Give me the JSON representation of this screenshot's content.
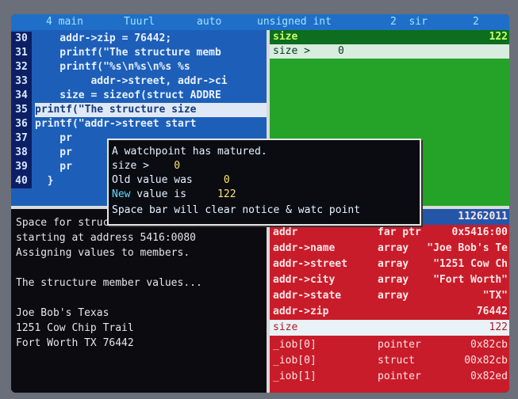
{
  "status_bar": {
    "mode": "4 main",
    "view": "Tuurl",
    "auto": "auto",
    "type": "unsigned int",
    "right1": "2  sir",
    "right2": "2"
  },
  "source": {
    "lines": [
      {
        "num": "30",
        "code": "    addr->zip = 76442;"
      },
      {
        "num": "31",
        "code": "    printf(\"The structure memb"
      },
      {
        "num": "32",
        "code": "    printf(\"%s\\n%s\\n%s %s"
      },
      {
        "num": "33",
        "code": "         addr->street, addr->ci"
      },
      {
        "num": "34",
        "code": "    size = sizeof(struct ADDRE"
      },
      {
        "num": "35",
        "code": "printf(\"The structure size"
      },
      {
        "num": "36",
        "code": "printf(\"addr->street start"
      },
      {
        "num": "37",
        "code": "    pr"
      },
      {
        "num": "38",
        "code": "    pr"
      },
      {
        "num": "39",
        "code": "    pr"
      },
      {
        "num": "40",
        "code": "  }"
      }
    ]
  },
  "watch_pane": {
    "header_left": "size",
    "header_right": "122",
    "row_name": "size >",
    "row_value": "0"
  },
  "notice": {
    "title": "A watchpoint has matured.",
    "size_label": "size >",
    "size_value": "0",
    "old_label": "Old value was",
    "old_value": "0",
    "new_word": "New",
    "new_label": " value is",
    "new_value": "122",
    "hint": "Space bar will clear notice & watc point"
  },
  "console": {
    "lines": [
      "Space for struc",
      "starting at address 5416:0080",
      "Assigning values to members.",
      "",
      "The structure member values...",
      "",
      "Joe Bob's Texas",
      "1251 Cow Chip Trail",
      "Fort Worth TX 76442"
    ]
  },
  "inspector": {
    "header_value": "11262011",
    "rows": [
      {
        "name": "addr",
        "type": "far ptr",
        "value": "0x5416:00"
      },
      {
        "name": "addr->name",
        "type": "array",
        "value": "\"Joe Bob's Te"
      },
      {
        "name": "addr->street",
        "type": "array",
        "value": "\"1251 Cow Ch"
      },
      {
        "name": "addr->city",
        "type": "array",
        "value": "\"Fort Worth\""
      },
      {
        "name": "addr->state",
        "type": "array",
        "value": "\"TX\""
      },
      {
        "name": "addr->zip",
        "type": "",
        "value": "76442"
      }
    ],
    "band_name": "size",
    "band_value": "122",
    "sub_rows": [
      {
        "name": "_iob[0]",
        "type": "pointer",
        "value": "0x82cb"
      },
      {
        "name": "_iob[0]",
        "type": "struct",
        "value": "00x82cb"
      },
      {
        "name": "_iob[1]",
        "type": "pointer",
        "value": "0x82ed"
      }
    ]
  }
}
